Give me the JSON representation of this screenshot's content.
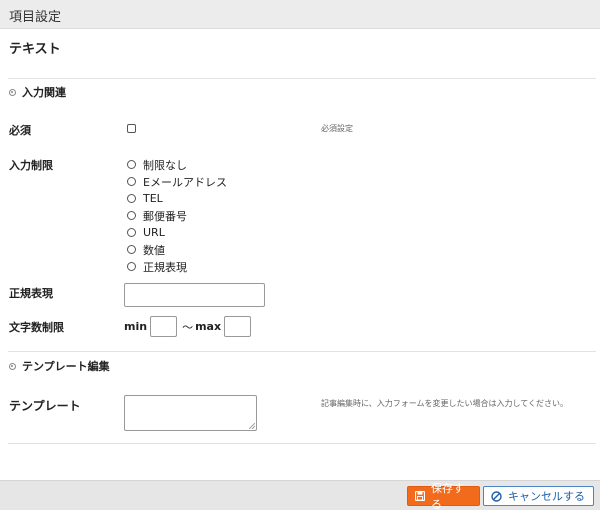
{
  "window": {
    "title": "項目設定"
  },
  "field": {
    "type_label": "テキスト"
  },
  "sections": {
    "input": "入力関連",
    "template": "テンプレート編集"
  },
  "required": {
    "label": "必須",
    "checked": false,
    "note": "必須設定"
  },
  "restriction": {
    "label": "入力制限",
    "options": [
      "制限なし",
      "Eメールアドレス",
      "TEL",
      "郵便番号",
      "URL",
      "数値",
      "正規表現"
    ],
    "selected": null
  },
  "regex": {
    "label": "正規表現",
    "value": ""
  },
  "length": {
    "label": "文字数制限",
    "min_label": "min",
    "sep": "〜",
    "max_label": "max",
    "min": "",
    "max": ""
  },
  "template": {
    "label": "テンプレート",
    "value": "",
    "note": "記事編集時に、入力フォームを変更したい場合は入力してください。"
  },
  "footer": {
    "save_label": "保存する",
    "cancel_label": "キャンセルする"
  },
  "colors": {
    "save_bg": "#f26a1b",
    "cancel_text": "#1d5fa8"
  },
  "icons": {
    "save": "floppy-disk-icon",
    "cancel": "prohibited-circle-icon"
  }
}
